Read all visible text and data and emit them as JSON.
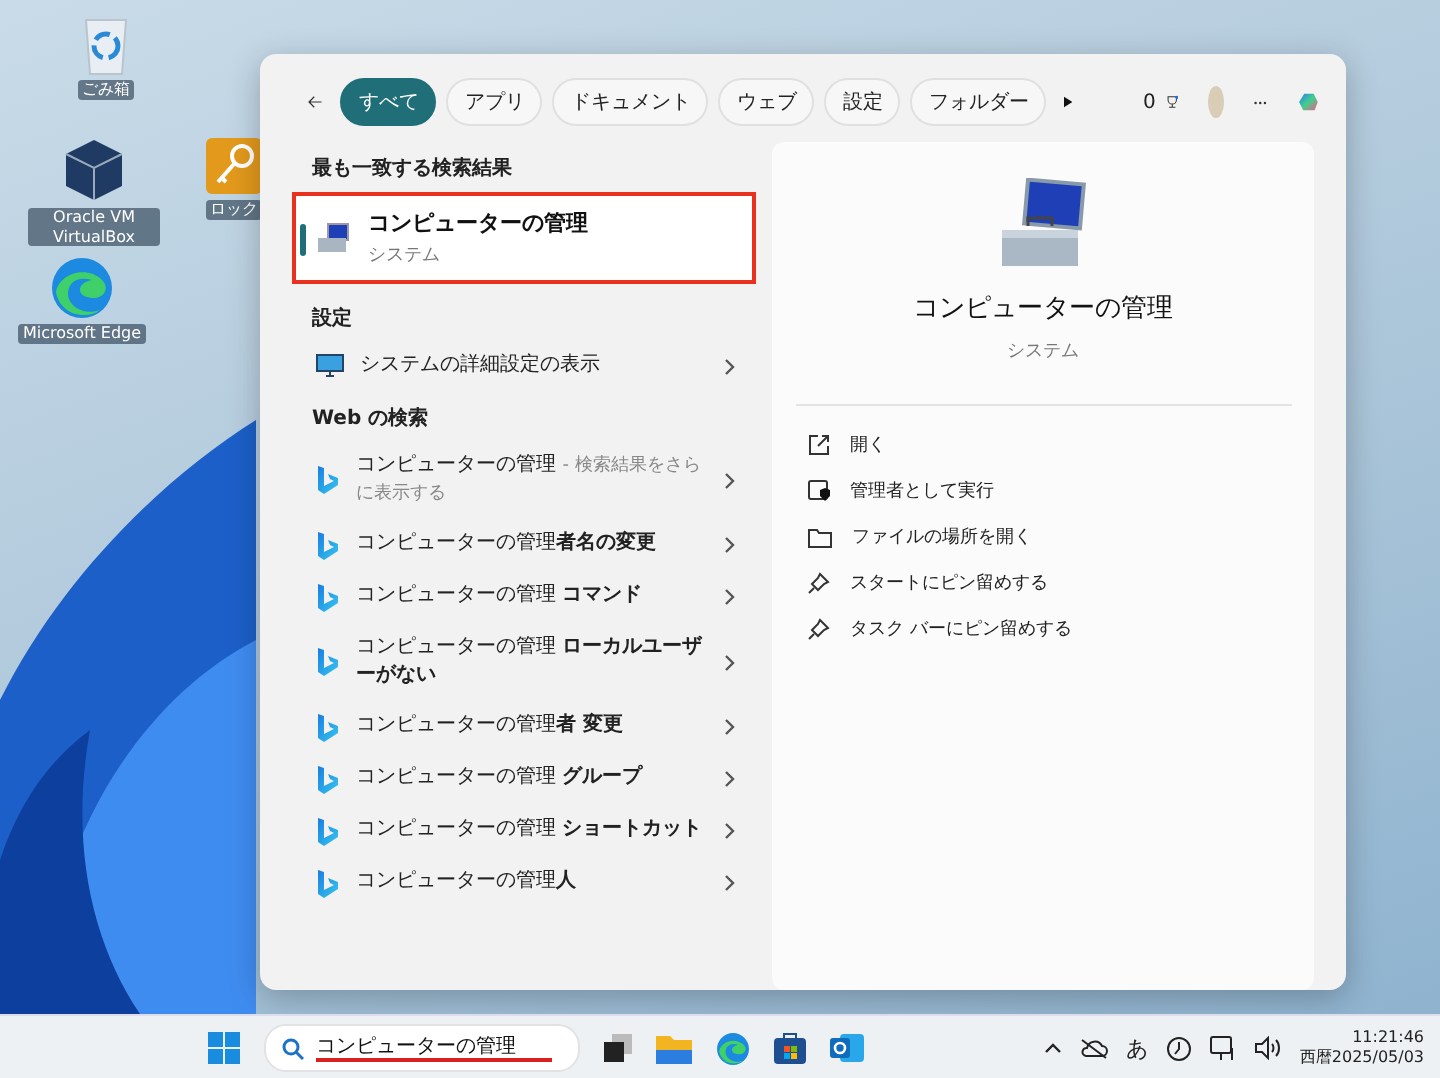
{
  "desktop_icons": [
    {
      "kind": "recycle",
      "label": "ごみ箱"
    },
    {
      "kind": "virtualbox",
      "label": "Oracle VM VirtualBox"
    },
    {
      "kind": "key",
      "label": "ロック"
    },
    {
      "kind": "edge",
      "label": "Microsoft Edge"
    }
  ],
  "search_panel": {
    "filters": [
      {
        "label": "すべて",
        "selected": true
      },
      {
        "label": "アプリ",
        "selected": false
      },
      {
        "label": "ドキュメント",
        "selected": false
      },
      {
        "label": "ウェブ",
        "selected": false
      },
      {
        "label": "設定",
        "selected": false
      },
      {
        "label": "フォルダー",
        "selected": false
      }
    ],
    "points": "0",
    "best_match": {
      "heading": "最も一致する検索結果",
      "title": "コンピューターの管理",
      "subtitle": "システム",
      "selected": true
    },
    "settings": {
      "heading": "設定",
      "items": [
        {
          "label": "システムの詳細設定の表示"
        }
      ]
    },
    "web": {
      "heading": "Web の検索",
      "items": [
        {
          "text": "コンピューターの管理",
          "note": "- 検索結果をさらに表示する"
        },
        {
          "text": "コンピューターの管理**者名の変更**"
        },
        {
          "text": "コンピューターの管理 **コマンド**"
        },
        {
          "text": "コンピューターの管理 **ローカルユーザーがない**"
        },
        {
          "text": "コンピューターの管理**者 変更**"
        },
        {
          "text": "コンピューターの管理 **グループ**"
        },
        {
          "text": "コンピューターの管理 **ショートカット**"
        },
        {
          "text": "コンピューターの管理**人**"
        }
      ]
    },
    "detail": {
      "title": "コンピューターの管理",
      "subtitle": "システム",
      "actions": [
        {
          "kind": "open",
          "label": "開く"
        },
        {
          "kind": "admin",
          "label": "管理者として実行"
        },
        {
          "kind": "folder",
          "label": "ファイルの場所を開く"
        },
        {
          "kind": "pin",
          "label": "スタートにピン留めする"
        },
        {
          "kind": "pin",
          "label": "タスク バーにピン留めする"
        }
      ]
    }
  },
  "taskbar": {
    "search_value": "コンピューターの管理",
    "ime": "あ",
    "time": "11:21:46",
    "date": "西暦2025/05/03"
  }
}
